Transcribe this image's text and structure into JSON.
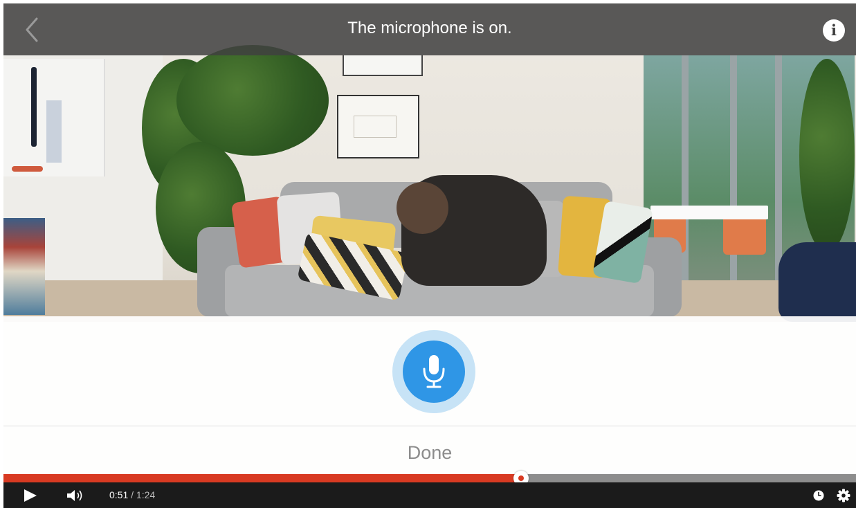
{
  "header": {
    "title": "The microphone is on.",
    "back_icon": "chevron-left-icon",
    "info_icon": "info-icon",
    "info_glyph": "i"
  },
  "mic_panel": {
    "mic_icon": "microphone-icon",
    "done_label": "Done",
    "accent_color": "#2f96e6"
  },
  "player": {
    "current_time": "0:51",
    "separator": " / ",
    "duration": "1:24",
    "progress": 0.6071,
    "progress_color": "#d83a22",
    "play_icon": "play-icon",
    "volume_icon": "volume-icon",
    "watch_later_icon": "clock-icon",
    "settings_icon": "gear-icon"
  }
}
